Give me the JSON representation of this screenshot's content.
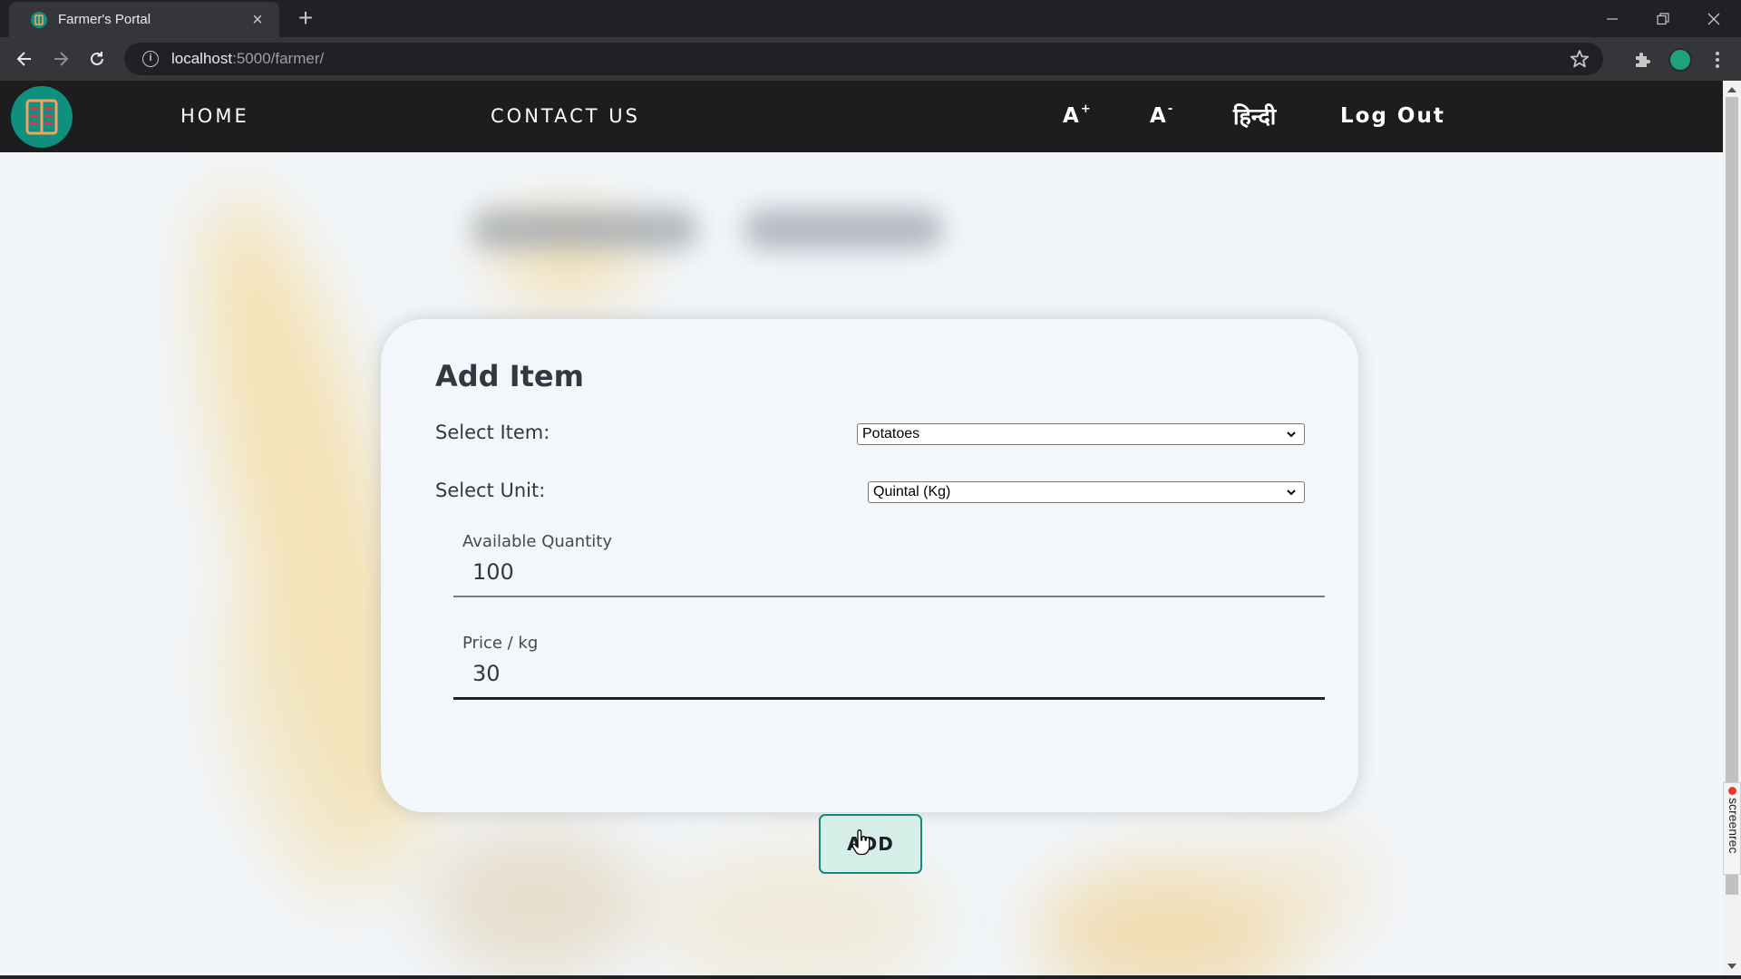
{
  "browser": {
    "tab_title": "Farmer's Portal",
    "url_host": "localhost",
    "url_path": ":5000/farmer/"
  },
  "nav": {
    "home": "HOME",
    "contact": "CONTACT US",
    "font_increase": "A",
    "font_increase_sign": "+",
    "font_decrease": "A",
    "font_decrease_sign": "-",
    "language": "हिन्दी",
    "logout": "Log Out"
  },
  "form": {
    "title": "Add Item",
    "item_label": "Select Item:",
    "item_selected": "Potatoes",
    "unit_label": "Select Unit:",
    "unit_selected": "Quintal (Kg)",
    "quantity_label": "Available Quantity",
    "quantity_value": "100",
    "price_label": "Price / kg",
    "price_value": "30",
    "submit_label": "ADD"
  },
  "overlay": {
    "recorder_text": "screenrec"
  },
  "colors": {
    "nav_bg": "#1d1d1d",
    "logo_bg": "#0f8f7e",
    "accent": "#14897a",
    "page_bg": "#f2f6fb"
  }
}
